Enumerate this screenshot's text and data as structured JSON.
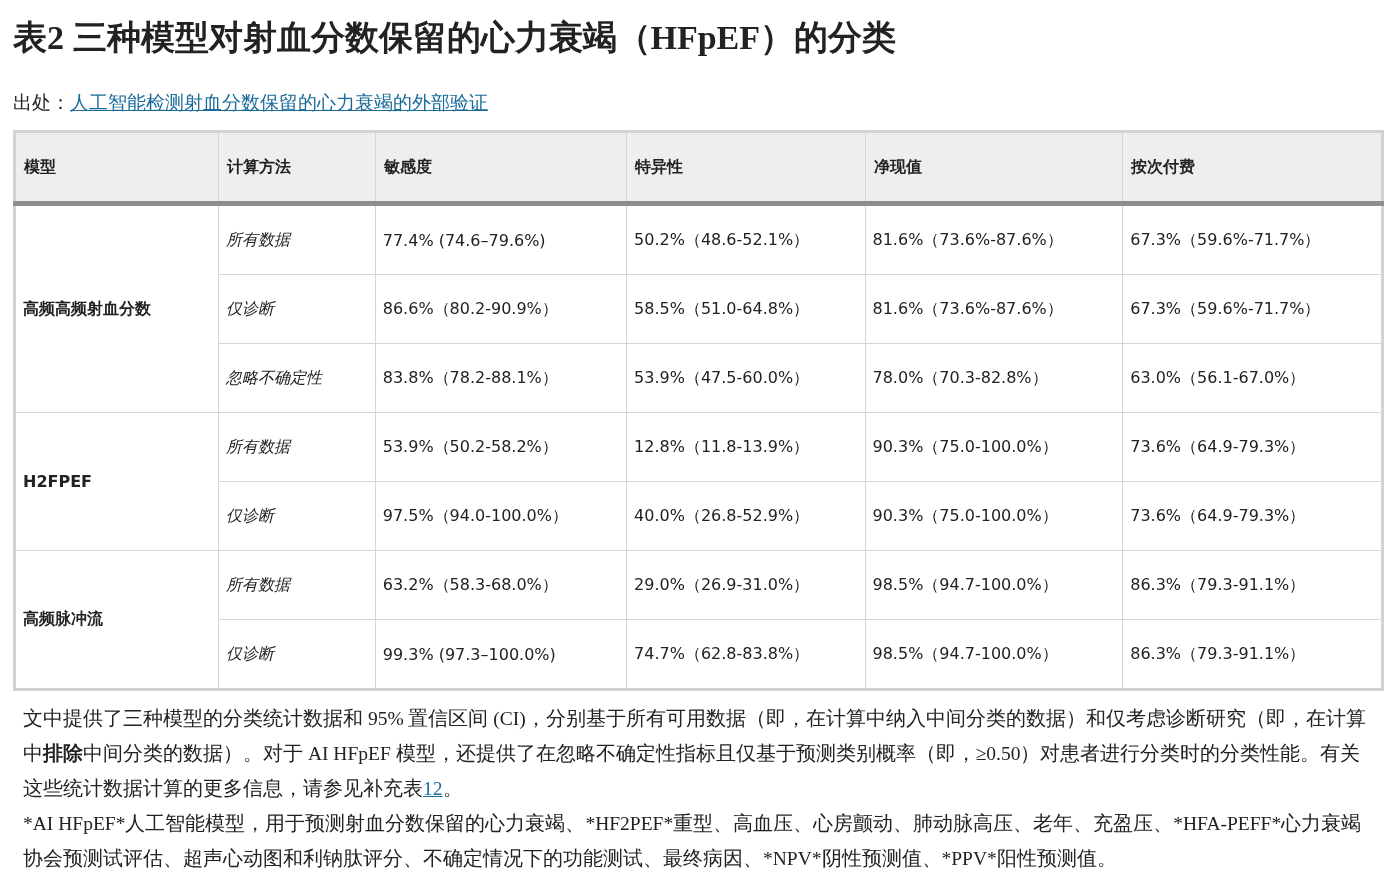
{
  "title": "表2 三种模型对射血分数保留的心力衰竭（HFpEF）的分类",
  "source": {
    "label": "出处：",
    "link": "人工智能检测射血分数保留的心力衰竭的外部验证"
  },
  "table": {
    "columns": [
      "模型",
      "计算方法",
      "敏感度",
      "特异性",
      "净现值",
      "按次付费"
    ],
    "groups": [
      {
        "model": "高频高频射血分数",
        "rows": [
          [
            "所有数据",
            "77.4% (74.6–79.6%)",
            "50.2%（48.6-52.1%）",
            "81.6%（73.6%-87.6%）",
            "67.3%（59.6%-71.7%）"
          ],
          [
            "仅诊断",
            "86.6%（80.2-90.9%）",
            "58.5%（51.0-64.8%）",
            "81.6%（73.6%-87.6%）",
            "67.3%（59.6%-71.7%）"
          ],
          [
            "忽略不确定性",
            "83.8%（78.2-88.1%）",
            "53.9%（47.5-60.0%）",
            "78.0%（70.3-82.8%）",
            "63.0%（56.1-67.0%）"
          ]
        ]
      },
      {
        "model": "H2FPEF",
        "rows": [
          [
            "所有数据",
            "53.9%（50.2-58.2%）",
            "12.8%（11.8-13.9%）",
            "90.3%（75.0-100.0%）",
            "73.6%（64.9-79.3%）"
          ],
          [
            "仅诊断",
            "97.5%（94.0-100.0%）",
            "40.0%（26.8-52.9%）",
            "90.3%（75.0-100.0%）",
            "73.6%（64.9-79.3%）"
          ]
        ]
      },
      {
        "model": "高频脉冲流",
        "rows": [
          [
            "所有数据",
            "63.2%（58.3-68.0%）",
            "29.0%（26.9-31.0%）",
            "98.5%（94.7-100.0%）",
            "86.3%（79.3-91.1%）"
          ],
          [
            "仅诊断",
            "99.3% (97.3–100.0%)",
            "74.7%（62.8-83.8%）",
            "98.5%（94.7-100.0%）",
            "86.3%（79.3-91.1%）"
          ]
        ]
      }
    ]
  },
  "footnote": {
    "text_before": "文中提供了三种模型的分类统计数据和 95% 置信区间 (CI)，分别基于所有可用数据（即，在计算中纳入中间分类的数据）和仅考虑诊断研究（即，在计算中**排除**中间分类的数据）。对于 AI HFpEF 模型，还提供了在忽略不确定性指标且仅基于预测类别概率（即，≥0.50）对患者进行分类时的分类性能。有关这些统计数据计算的更多信息，请参见补充表",
    "link": "12",
    "text_after": "。"
  },
  "abbreviations": "*AI HFpEF*人工智能模型，用于预测射血分数保留的心力衰竭、*HF2PEF*重型、高血压、心房颤动、肺动脉高压、老年、充盈压、*HFA-PEFF*心力衰竭协会预测试评估、超声心动图和利钠肽评分、不确定情况下的功能测试、最终病因、*NPV*阴性预测值、*PPV*阳性预测值。"
}
